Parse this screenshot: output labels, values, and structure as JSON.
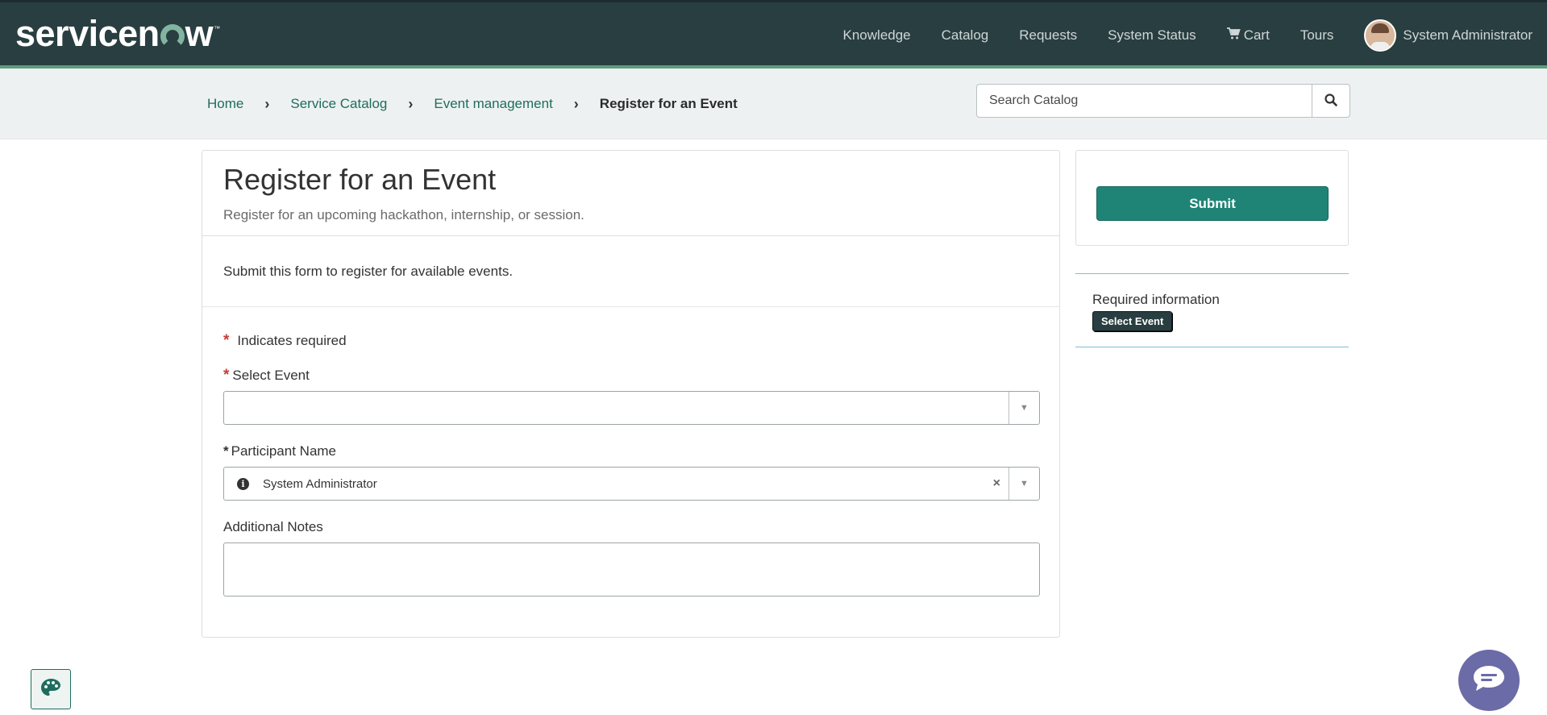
{
  "header": {
    "logo_text_a": "servicen",
    "logo_text_b": "w",
    "logo_tm": "™",
    "nav": {
      "knowledge": "Knowledge",
      "catalog": "Catalog",
      "requests": "Requests",
      "system_status": "System Status",
      "cart": "Cart",
      "tours": "Tours",
      "user": "System Administrator"
    }
  },
  "breadcrumb": {
    "items": [
      "Home",
      "Service Catalog",
      "Event management"
    ],
    "current": "Register for an Event"
  },
  "search": {
    "placeholder": "Search Catalog"
  },
  "form": {
    "title": "Register for an Event",
    "subtitle": "Register for an upcoming hackathon, internship, or session.",
    "description": "Submit this form to register for available events.",
    "required_note": "Indicates required",
    "fields": {
      "select_event_label": "Select Event",
      "select_event_value": "",
      "participant_label": "Participant Name",
      "participant_value": "System Administrator",
      "notes_label": "Additional Notes",
      "notes_value": ""
    }
  },
  "sidebar": {
    "submit_label": "Submit",
    "required_title": "Required information",
    "required_items": [
      "Select Event"
    ]
  },
  "colors": {
    "header_bg": "#293e40",
    "accent_green": "#1f8476",
    "link": "#1f6d5e",
    "required_star": "#c83c36",
    "chat_bg": "#6b6ba8"
  }
}
